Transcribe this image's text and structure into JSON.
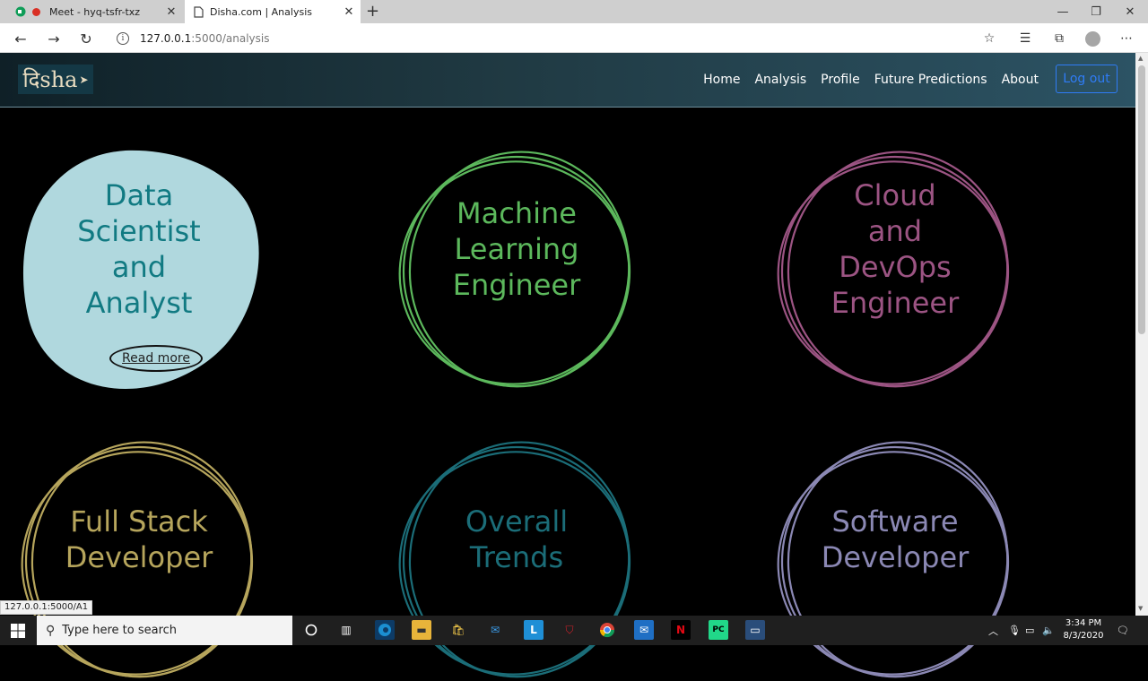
{
  "browser": {
    "tabs": [
      {
        "title": "Meet - hyq-tsfr-txz"
      },
      {
        "title": "Disha.com | Analysis"
      }
    ],
    "new_tab": "+",
    "url_host": "127.0.0.1",
    "url_path": ":5000/analysis",
    "status_url": "127.0.0.1:5000/A1"
  },
  "site": {
    "logo": "दिsha",
    "nav": [
      "Home",
      "Analysis",
      "Profile",
      "Future Predictions",
      "About"
    ],
    "logout": "Log out"
  },
  "cards": [
    {
      "lines": [
        "Data",
        "Scientist",
        "and",
        "Analyst"
      ],
      "color": "#117a82",
      "action": "Read more"
    },
    {
      "lines": [
        "Machine",
        "Learning",
        "Engineer"
      ],
      "color": "#5cb85c"
    },
    {
      "lines": [
        "Cloud",
        "and",
        "DevOps",
        "Engineer"
      ],
      "color": "#9c5483"
    },
    {
      "lines": [
        "Full Stack",
        "Developer"
      ],
      "color": "#b6a55c"
    },
    {
      "lines": [
        "Overall",
        "Trends"
      ],
      "color": "#1b6d78"
    },
    {
      "lines": [
        "Software",
        "Developer"
      ],
      "color": "#8b88b4"
    }
  ],
  "taskbar": {
    "search_placeholder": "Type here to search",
    "time": "3:34 PM",
    "date": "8/3/2020"
  }
}
